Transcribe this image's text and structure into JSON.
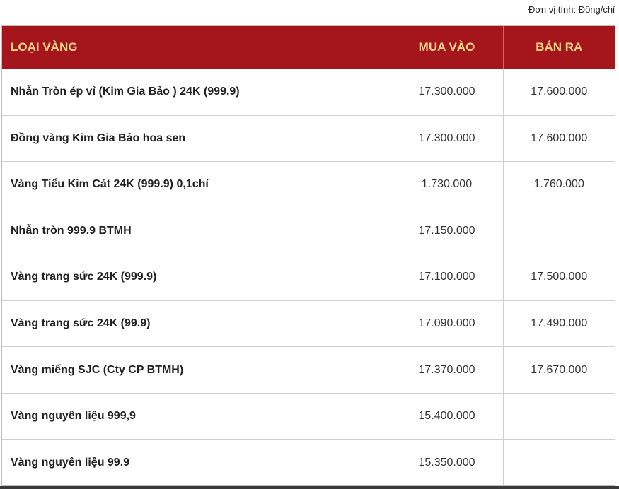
{
  "unit_note": "Đơn vị tính: Đồng/chỉ",
  "colors": {
    "header_bg": "#a5161c",
    "header_text": "#f4d58d"
  },
  "table": {
    "headers": {
      "type": "LOẠI VÀNG",
      "buy": "MUA VÀO",
      "sell": "BÁN RA"
    },
    "rows": [
      {
        "name": "Nhẫn Tròn ép vỉ (Kim Gia Bảo ) 24K (999.9)",
        "buy": "17.300.000",
        "sell": "17.600.000"
      },
      {
        "name": "Đồng vàng Kim Gia Bảo hoa sen",
        "buy": "17.300.000",
        "sell": "17.600.000"
      },
      {
        "name": "Vàng Tiểu Kim Cát 24K (999.9) 0,1chỉ",
        "buy": "1.730.000",
        "sell": "1.760.000"
      },
      {
        "name": "Nhẫn tròn 999.9 BTMH",
        "buy": "17.150.000",
        "sell": ""
      },
      {
        "name": "Vàng trang sức 24K (999.9)",
        "buy": "17.100.000",
        "sell": "17.500.000"
      },
      {
        "name": "Vàng trang sức 24K (99.9)",
        "buy": "17.090.000",
        "sell": "17.490.000"
      },
      {
        "name": "Vàng miếng SJC (Cty CP BTMH)",
        "buy": "17.370.000",
        "sell": "17.670.000"
      },
      {
        "name": "Vàng nguyên liệu 999,9",
        "buy": "15.400.000",
        "sell": ""
      },
      {
        "name": "Vàng nguyên liệu 99.9",
        "buy": "15.350.000",
        "sell": ""
      }
    ]
  }
}
